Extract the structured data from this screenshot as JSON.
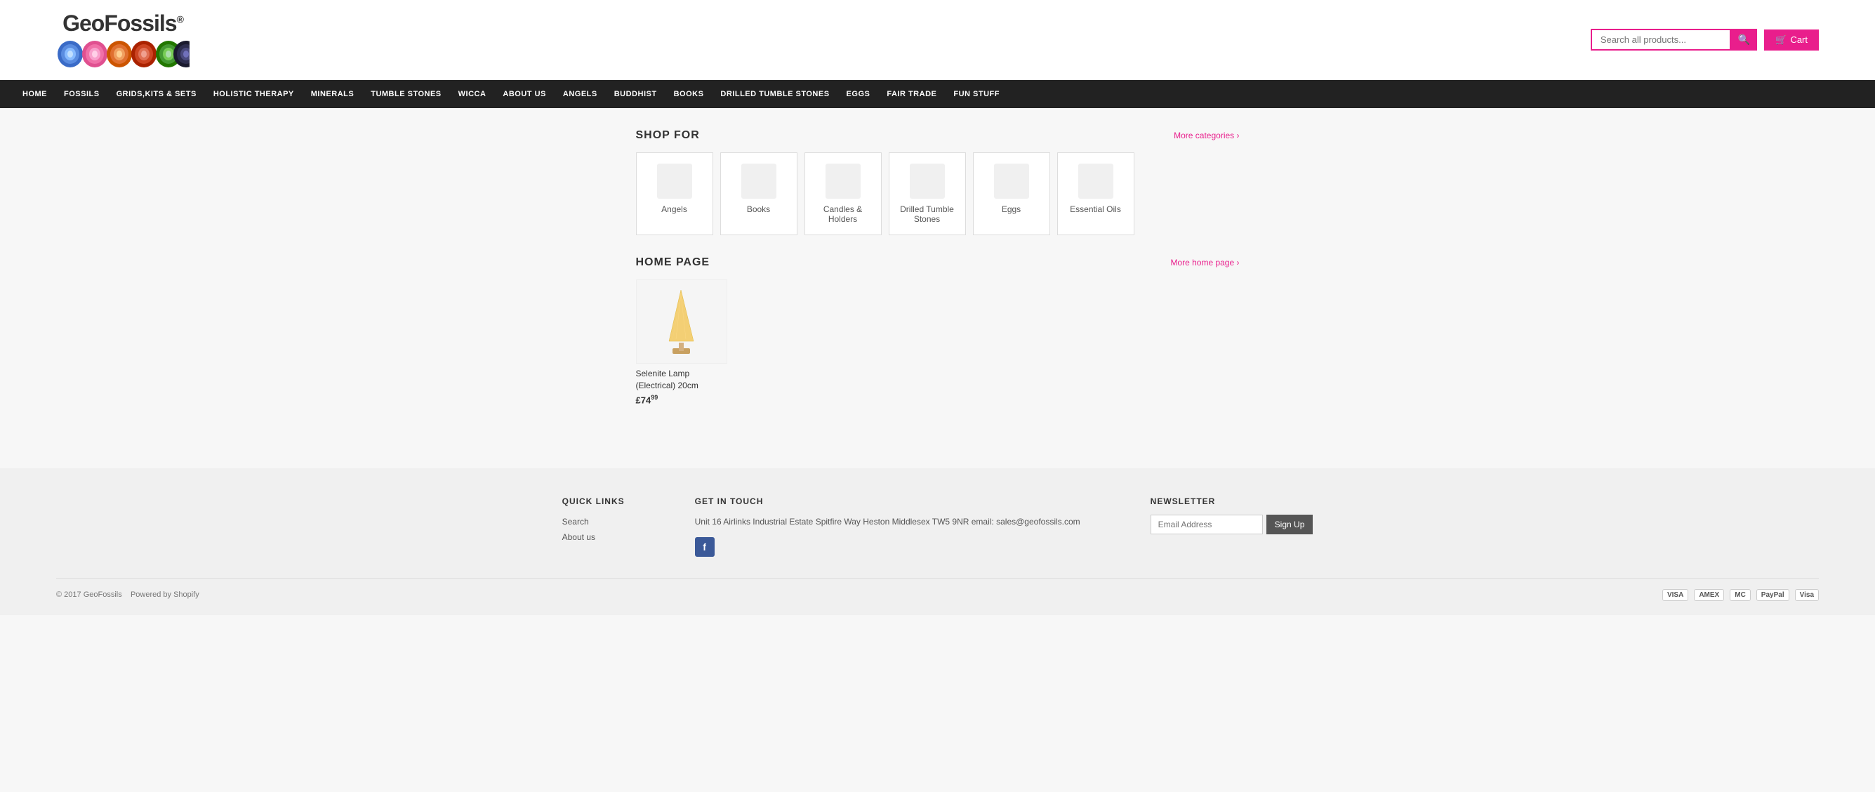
{
  "site": {
    "title": "GeoFossils",
    "registered_mark": "®"
  },
  "header": {
    "search_placeholder": "Search all products...",
    "cart_label": "Cart",
    "cart_icon": "🛒"
  },
  "nav": {
    "items": [
      {
        "label": "HOME",
        "id": "home"
      },
      {
        "label": "FOSSILS",
        "id": "fossils"
      },
      {
        "label": "GRIDS,KITS & SETS",
        "id": "grids"
      },
      {
        "label": "HOLISTIC THERAPY",
        "id": "holistic"
      },
      {
        "label": "MINERALS",
        "id": "minerals"
      },
      {
        "label": "TUMBLE STONES",
        "id": "tumble"
      },
      {
        "label": "WICCA",
        "id": "wicca"
      },
      {
        "label": "ABOUT US",
        "id": "about"
      },
      {
        "label": "ANGELS",
        "id": "angels"
      },
      {
        "label": "BUDDHIST",
        "id": "buddhist"
      },
      {
        "label": "BOOKS",
        "id": "books"
      },
      {
        "label": "DRILLED TUMBLE STONES",
        "id": "drilled"
      },
      {
        "label": "EGGS",
        "id": "eggs"
      },
      {
        "label": "FAIR TRADE",
        "id": "fair"
      },
      {
        "label": "FUN STUFF",
        "id": "fun"
      }
    ]
  },
  "shop_for": {
    "title": "SHOP FOR",
    "more_link": "More categories ›",
    "categories": [
      {
        "name": "Angels",
        "id": "angels"
      },
      {
        "name": "Books",
        "id": "books"
      },
      {
        "name": "Candles & Holders",
        "id": "candles"
      },
      {
        "name": "Drilled Tumble Stones",
        "id": "drilled"
      },
      {
        "name": "Eggs",
        "id": "eggs"
      },
      {
        "name": "Essential Oils",
        "id": "oils"
      }
    ]
  },
  "home_page": {
    "title": "HOME PAGE",
    "more_link": "More home page ›",
    "products": [
      {
        "name": "Selenite Lamp (Electrical) 20cm",
        "price": "£74",
        "price_decimal": "99",
        "id": "selenite-lamp"
      }
    ]
  },
  "footer": {
    "quick_links": {
      "title": "QUICK LINKS",
      "items": [
        {
          "label": "Search",
          "id": "search"
        },
        {
          "label": "About us",
          "id": "about"
        }
      ]
    },
    "get_in_touch": {
      "title": "GET IN TOUCH",
      "address": "Unit 16 Airlinks Industrial Estate Spitfire Way Heston Middlesex TW5 9NR email: sales@geofossils.com"
    },
    "newsletter": {
      "title": "NEWSLETTER",
      "email_placeholder": "Email Address",
      "signup_label": "Sign Up"
    },
    "copyright": "© 2017 GeoFossils",
    "powered_by": "Powered by Shopify",
    "payment_methods": [
      "visa",
      "mastercard",
      "amex",
      "paypal",
      "visa2"
    ]
  }
}
